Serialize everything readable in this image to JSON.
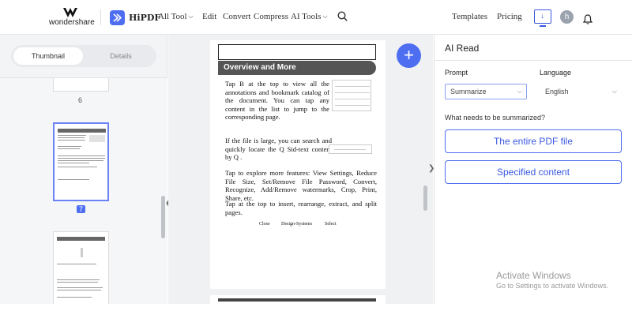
{
  "brand": {
    "company": "wondershare",
    "app": "HiPDF"
  },
  "nav": [
    {
      "label": "All Tool",
      "dropdown": true
    },
    {
      "label": "Edit",
      "dropdown": false
    },
    {
      "label": "Convert",
      "dropdown": false
    },
    {
      "label": "Compress",
      "dropdown": false
    },
    {
      "label": "AI Tools",
      "dropdown": true
    }
  ],
  "topright": {
    "templates": "Templates",
    "pricing": "Pricing",
    "avatar_letter": "h"
  },
  "sidebar": {
    "tabs": [
      {
        "label": "Thumbnail",
        "active": true
      },
      {
        "label": "Details",
        "active": false
      }
    ],
    "pages": [
      {
        "number": "6"
      },
      {
        "number": "7",
        "selected": true
      }
    ]
  },
  "document": {
    "banner": "Overview and More",
    "para1": "Tap B at the top to view all the annotations and bookmark catalog of the document. You can tap any content in the list to jump to the corresponding page.",
    "para2": "If the file is large, you can search and quickly locate the Q Sid-text content by Q .",
    "para3": "Tap to explore more features: View Settings, Reduce File Size, Set/Remove File Password, Convert, Recognize, Add/Remove watermarks, Crop, Print, Share, etc.",
    "para4": "Tap at the top to insert, rearrange, extract, and split pages.",
    "footer": [
      "Close",
      "Design-Systems",
      "Select"
    ]
  },
  "ai_panel": {
    "title": "AI Read",
    "prompt_label": "Prompt",
    "prompt_value": "Summarize",
    "language_label": "Language",
    "language_value": "English",
    "question": "What needs to be summarized?",
    "option1": "The entire PDF file",
    "option2": "Specified content"
  },
  "watermark": {
    "line1": "Activate Windows",
    "line2": "Go to Settings to activate Windows."
  },
  "colors": {
    "accent": "#4e6ef2"
  }
}
